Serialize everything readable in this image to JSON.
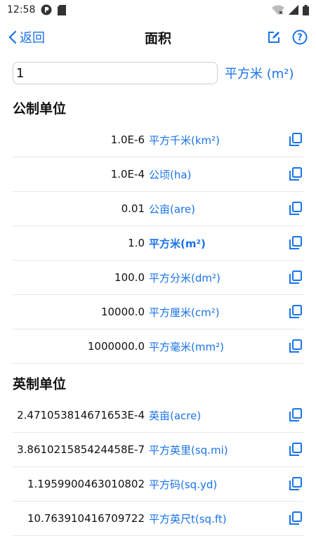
{
  "status_bar": {
    "time": "12:58"
  },
  "header": {
    "back_label": "返回",
    "title": "面积"
  },
  "input": {
    "value": "1",
    "unit": "平方米 (m²)"
  },
  "sections": [
    {
      "title": "公制单位",
      "rows": [
        {
          "value": "1.0E-6",
          "unit": "平方千米(km²)"
        },
        {
          "value": "1.0E-4",
          "unit": "公顷(ha)"
        },
        {
          "value": "0.01",
          "unit": "公亩(are)"
        },
        {
          "value": "1.0",
          "unit": "平方米(m²)",
          "current": true
        },
        {
          "value": "100.0",
          "unit": "平方分米(dm²)"
        },
        {
          "value": "10000.0",
          "unit": "平方厘米(cm²)"
        },
        {
          "value": "1000000.0",
          "unit": "平方毫米(mm²)"
        }
      ]
    },
    {
      "title": "英制单位",
      "rows": [
        {
          "value": "2.471053814671653E-4",
          "unit": "英亩(acre)"
        },
        {
          "value": "3.861021585424458E-7",
          "unit": "平方英里(sq.mi)"
        },
        {
          "value": "1.1959900463010802",
          "unit": "平方码(sq.yd)"
        },
        {
          "value": "10.763910416709722",
          "unit": "平方英尺t(sq.ft)"
        }
      ]
    }
  ],
  "colors": {
    "accent": "#1a73e8",
    "divider": "#e6e6e6"
  }
}
